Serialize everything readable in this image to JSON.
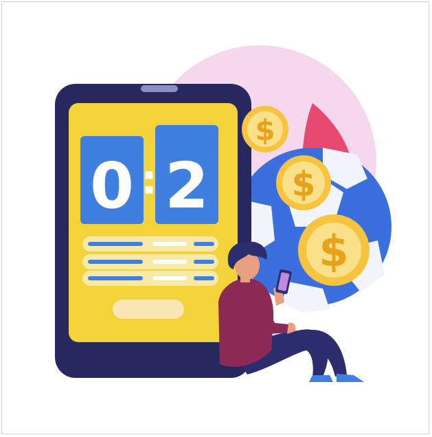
{
  "scoreboard": {
    "home_score": "0",
    "separator": ":",
    "away_score": "2"
  },
  "coins": {
    "symbol": "$"
  },
  "colors": {
    "tablet_frame": "#27285e",
    "tablet_screen": "#f3d23a",
    "score_panel": "#3f7fe0",
    "pink_circle": "#f6d8ee",
    "coin_gold": "#f7c43f",
    "ball_blue": "#3b6fe0",
    "flame_red": "#e84a6f",
    "shirt": "#8b2a55",
    "pants": "#2b2d6e"
  },
  "icons": [
    "tablet-icon",
    "scoreboard-icon",
    "coin-icon",
    "soccer-ball-icon",
    "person-with-phone-icon"
  ]
}
